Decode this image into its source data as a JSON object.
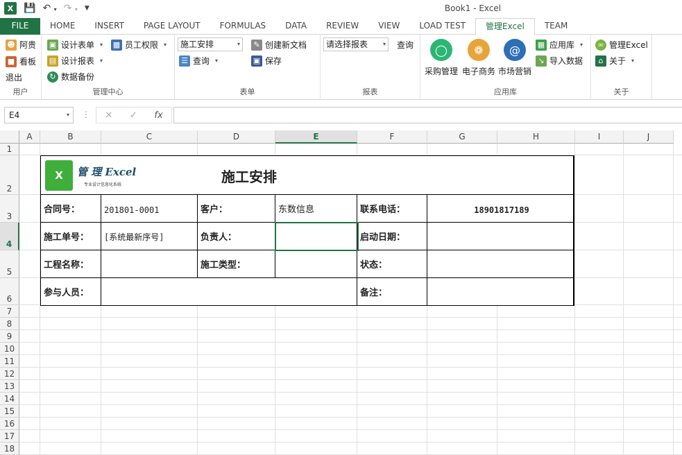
{
  "titlebar": {
    "app_icon": "X",
    "title": "Book1 - Excel"
  },
  "tabs": [
    "FILE",
    "HOME",
    "INSERT",
    "PAGE LAYOUT",
    "FORMULAS",
    "DATA",
    "REVIEW",
    "VIEW",
    "LOAD TEST",
    "管理Excel",
    "TEAM"
  ],
  "ribbon": {
    "user": {
      "label": "用户",
      "items": [
        "阿贵",
        "看板",
        "退出"
      ]
    },
    "manage": {
      "label": "管理中心",
      "design_form": "设计表单",
      "staff_perm": "员工权限",
      "design_report": "设计报表",
      "backup": "数据备份"
    },
    "forms": {
      "label": "表单",
      "combo_value": "施工安排",
      "query": "查询",
      "new_doc": "创建新文档",
      "save": "保存"
    },
    "reports": {
      "label": "报表",
      "combo_value": "请选择报表",
      "query": "查询"
    },
    "apps": {
      "label": "应用库",
      "purchase": "采购管理",
      "ecommerce": "电子商务",
      "marketing": "市场营销",
      "app_lib": "应用库",
      "import": "导入数据"
    },
    "about": {
      "label": "关于",
      "manage_excel": "管理Excel",
      "about": "关于"
    }
  },
  "formula_bar": {
    "name_box": "E4",
    "fx": "fx",
    "value": ""
  },
  "columns": [
    "A",
    "B",
    "C",
    "D",
    "E",
    "F",
    "G",
    "H",
    "I",
    "J"
  ],
  "rows": [
    "1",
    "2",
    "3",
    "4",
    "5",
    "6",
    "7",
    "8",
    "9",
    "10",
    "11",
    "12",
    "13",
    "14",
    "15",
    "16",
    "17",
    "18"
  ],
  "form": {
    "logo_mark": "X",
    "logo_text": "管 理 Excel",
    "logo_sub": "专业设计信息化系统",
    "title": "施工安排",
    "contract_no_label": "合同号：",
    "contract_no": "201801-0001",
    "customer_label": "客户：",
    "customer": "东数信息",
    "phone_label": "联系电话：",
    "phone": "18901817189",
    "order_no_label": "施工单号：",
    "order_no": "[系统最新序号]",
    "owner_label": "负责人：",
    "start_label": "启动日期：",
    "project_label": "工程名称：",
    "type_label": "施工类型：",
    "status_label": "状态：",
    "members_label": "参与人员：",
    "note_label": "备注："
  }
}
